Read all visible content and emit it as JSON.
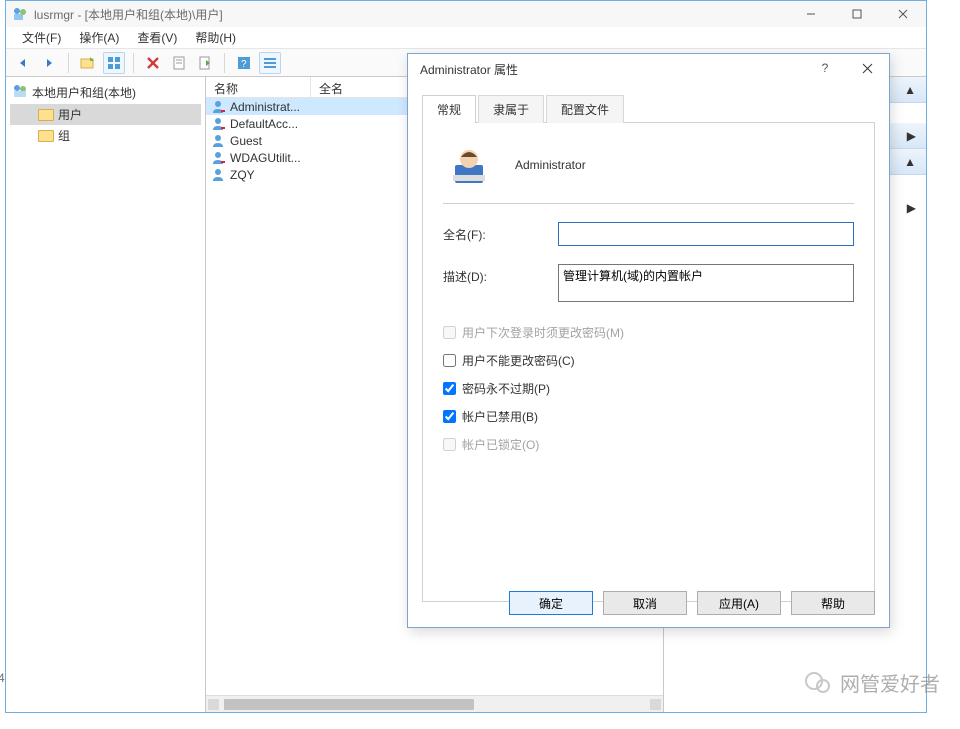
{
  "window": {
    "title": "lusrmgr - [本地用户和组(本地)\\用户]",
    "menu": {
      "file": "文件(F)",
      "action": "操作(A)",
      "view": "查看(V)",
      "help": "帮助(H)"
    }
  },
  "tree": {
    "root": "本地用户和组(本地)",
    "children": [
      "用户",
      "组"
    ],
    "selected": 0
  },
  "list": {
    "cols": {
      "name": "名称",
      "fullname": "全名"
    },
    "rows": [
      "Administrat...",
      "DefaultAcc...",
      "Guest",
      "WDAGUtilit...",
      "ZQY"
    ],
    "selected": 0
  },
  "dialog": {
    "title": "Administrator 属性",
    "tabs": {
      "general": "常规",
      "memberof": "隶属于",
      "profile": "配置文件"
    },
    "username": "Administrator",
    "labels": {
      "fullname": "全名(F):",
      "description": "描述(D):"
    },
    "values": {
      "fullname": "",
      "description": "管理计算机(域)的内置帐户"
    },
    "checks": {
      "mustchange": "用户下次登录时须更改密码(M)",
      "cannotchange": "用户不能更改密码(C)",
      "neverexpire": "密码永不过期(P)",
      "disabled": "帐户已禁用(B)",
      "locked": "帐户已锁定(O)"
    },
    "buttons": {
      "ok": "确定",
      "cancel": "取消",
      "apply": "应用(A)",
      "help": "帮助"
    }
  },
  "watermark": "网管爱好者",
  "page_no": "4"
}
